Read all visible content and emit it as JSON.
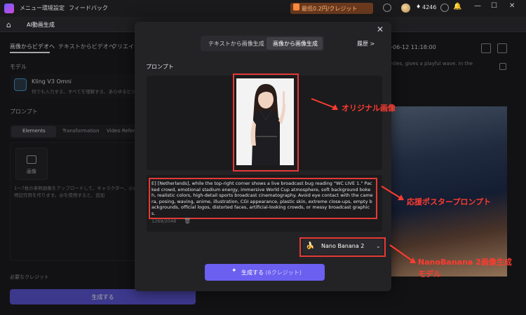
{
  "topbar": {
    "menu": [
      "メニュー",
      "環境設定",
      "フィードバック"
    ],
    "promo": "最低0.2円/クレジット",
    "credits": "4246"
  },
  "secbar": {
    "title": "AI動画生成"
  },
  "left": {
    "tabs": [
      "画像からビデオへ",
      "テキストからビデオへ",
      "クリエイティ"
    ],
    "model_label": "モデル",
    "model_name": "Kling V3 Omni",
    "model_desc": "何でも入力する、すべてを理解する、あらゆるビジョンを",
    "prompt_label": "プロンプト",
    "segments": [
      "Elements",
      "Transformation",
      "Video Refere"
    ],
    "upload_label": "画像",
    "hint": "1～7枚の参照画像をアップロードして、キャラクター、小道具、背景などを設定し、動的な明記作用を作ります。@を使用すると、追加",
    "required_credits": "必要なクレジット",
    "generate": "生成する"
  },
  "right": {
    "timestamp": "6-06-12 11:18:00",
    "desc": "niles, gives a playful wave. In the"
  },
  "modal": {
    "tabs": [
      "テキストから画像生成",
      "画像から画像生成"
    ],
    "history": "履歴 >",
    "prompt_label": "プロンプト",
    "prompt_text": "E] [Netherlands], while the top-right corner shows a live broadcast bug reading \"WC LIVE 1.\" Packed crowd, emotional stadium energy, immersive World Cup atmosphere, soft background bokeh, realistic colors, high-detail sports broadcast cinematography. Avoid eye contact with the camera, posing, waving, anime, illustration, CGI appearance, plastic skin, extreme close-ups, empty backgrounds, official logos, distorted faces, artificial-looking crowds, or messy broadcast graphics.",
    "counter": "1269/2048",
    "model": "Nano Banana 2",
    "generate": "生成する",
    "generate_sub": "(6クレジット)"
  },
  "annotations": {
    "original_image": "オリジナル画像",
    "poster_prompt": "応援ポスタープロンプト",
    "model_note_1": "NanoBanana 2画像生成",
    "model_note_2": "モデル"
  },
  "colors": {
    "accent": "#6b5ff0",
    "highlight": "#e53935"
  },
  "icons": [
    "home-icon",
    "close-icon",
    "trash-icon",
    "chevron-down-icon",
    "banana-icon",
    "sparkle-icon",
    "edit-icon",
    "copy-icon",
    "gift-icon",
    "bell-icon"
  ]
}
